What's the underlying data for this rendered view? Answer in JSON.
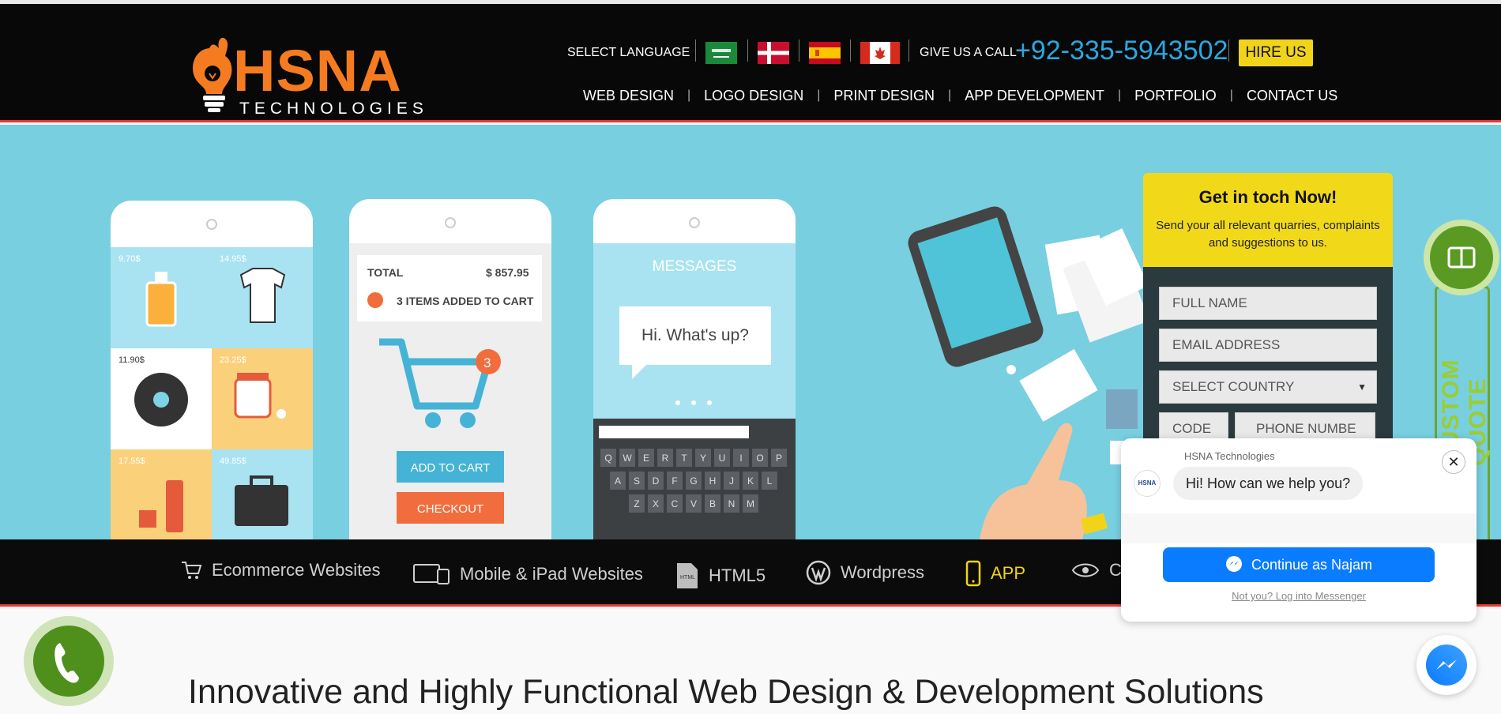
{
  "header": {
    "logo_main": "HSNA",
    "logo_sub": "TECHNOLOGIES",
    "language_label": "SELECT LANGUAGE",
    "flags": [
      "saudi-arabia-flag",
      "denmark-flag",
      "spain-flag",
      "canada-flag"
    ],
    "call_label": "GIVE US A CALL",
    "phone": "+92-335-5943502",
    "hire_label": "HIRE US",
    "nav": [
      "WEB DESIGN",
      "LOGO DESIGN",
      "PRINT DESIGN",
      "APP DEVELOPMENT",
      "PORTFOLIO",
      "CONTACT US"
    ]
  },
  "hero": {
    "phone1": {
      "prices": [
        "9.70$",
        "14.95$",
        "11.90$",
        "23.25$",
        "17.55$",
        "49.85$"
      ]
    },
    "phone2": {
      "total_label": "TOTAL",
      "total_value": "$ 857.95",
      "items_label": "3 ITEMS ADDED TO CART",
      "cart_count": "3",
      "add_to_cart": "ADD TO CART",
      "checkout": "CHECKOUT"
    },
    "phone3": {
      "title": "MESSAGES",
      "bubble": "Hi. What's up?",
      "keyboard_rows": [
        [
          "Q",
          "W",
          "E",
          "R",
          "T",
          "Y",
          "U",
          "I",
          "O",
          "P"
        ],
        [
          "A",
          "S",
          "D",
          "F",
          "G",
          "H",
          "J",
          "K",
          "L"
        ],
        [
          "Z",
          "X",
          "C",
          "V",
          "B",
          "N",
          "M"
        ]
      ]
    }
  },
  "form": {
    "title": "Get in toch Now!",
    "subtitle": "Send your all relevant quarries, complaints and suggestions to us.",
    "full_name_placeholder": "FULL NAME",
    "email_placeholder": "EMAIL ADDRESS",
    "country_placeholder": "SELECT COUNTRY",
    "code_placeholder": "CODE",
    "phone_placeholder": "PHONE NUMBE"
  },
  "side_tab": {
    "label": "CUSTOM QUOTE"
  },
  "services": [
    {
      "label": "Ecommerce Websites",
      "icon": "cart-icon",
      "active": false
    },
    {
      "label": "Mobile & iPad Websites",
      "icon": "devices-icon",
      "active": false
    },
    {
      "label": "HTML5",
      "icon": "html-file-icon",
      "active": false
    },
    {
      "label": "Wordpress",
      "icon": "wordpress-icon",
      "active": false
    },
    {
      "label": "APP",
      "icon": "mobile-phone-icon",
      "active": true
    },
    {
      "label": "Cu",
      "icon": "eye-icon",
      "active": false
    }
  ],
  "headline": "Innovative and Highly Functional Web Design & Development Solutions",
  "messenger": {
    "page_name": "HSNA Technologies",
    "avatar_text": "HSNA",
    "greeting": "Hi! How can we help you?",
    "continue_label": "Continue as Najam",
    "login_label": "Not you? Log into Messenger"
  },
  "colors": {
    "brand_orange": "#f47b20",
    "phone_blue": "#29a8e0",
    "accent_yellow": "#f1d31a",
    "hero_bg": "#78cfe0",
    "divider_red": "#e53935",
    "messenger_blue": "#0a7cff",
    "call_green": "#4f8f1c"
  }
}
